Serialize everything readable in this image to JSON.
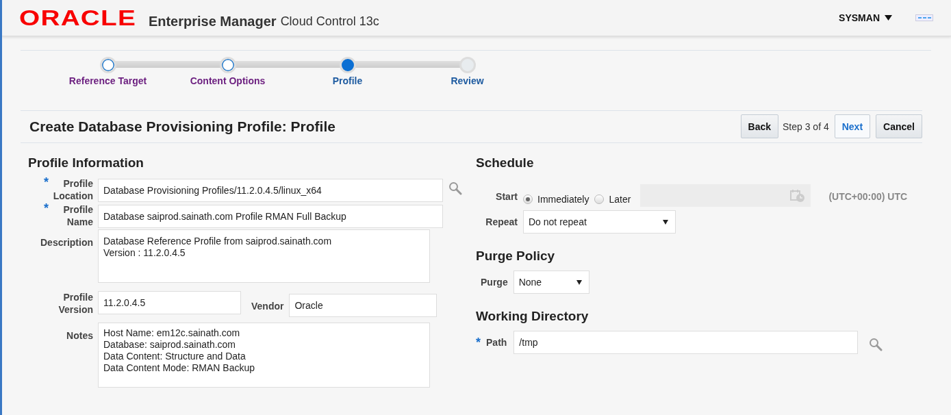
{
  "header": {
    "logo": "ORACLE",
    "product": "Enterprise Manager",
    "edition": "Cloud Control 13c",
    "user": "SYSMAN"
  },
  "train": [
    {
      "label": "Reference Target",
      "visited": true,
      "selected": false
    },
    {
      "label": "Content Options",
      "visited": true,
      "selected": false
    },
    {
      "label": "Profile",
      "visited": false,
      "selected": true
    },
    {
      "label": "Review",
      "visited": false,
      "selected": false
    }
  ],
  "page_title": "Create Database Provisioning Profile: Profile",
  "nav": {
    "back": "Back",
    "step": "Step 3 of 4",
    "next": "Next",
    "next_hovered": true,
    "cancel": "Cancel"
  },
  "profile_information": {
    "title": "Profile Information",
    "fields": [
      {
        "kind": "search",
        "label": "Profile Location",
        "required_mark": "*",
        "value": "Database Provisioning Profiles/11.2.0.4.5/linux_x64"
      },
      {
        "kind": "text",
        "label": "Profile Name",
        "required_mark": "*",
        "value": "Database saiprod.sainath.com Profile RMAN Full Backup"
      },
      {
        "kind": "textarea",
        "label": "Description",
        "value": "Database Reference Profile from saiprod.sainath.com\nVersion : 11.2.0.4.5"
      },
      {
        "kind": "pair",
        "label": "Profile Version",
        "value": "11.2.0.4.5",
        "label2": "Vendor",
        "value2": "Oracle"
      },
      {
        "kind": "notes",
        "label": "Notes",
        "value": "Host Name: em12c.sainath.com\nDatabase: saiprod.sainath.com\nData Content: Structure and Data\nData Content Mode: RMAN Backup"
      }
    ]
  },
  "schedule": {
    "title": "Schedule",
    "start_label": "Start",
    "options": [
      {
        "label": "Immediately",
        "selected": true
      },
      {
        "label": "Later",
        "selected": false
      }
    ],
    "date_disabled": true,
    "timezone": "(UTC+00:00) UTC",
    "repeat_label": "Repeat",
    "repeat": "Do not repeat"
  },
  "purge_policy": {
    "title": "Purge Policy",
    "label": "Purge",
    "value": "None"
  },
  "working_directory": {
    "title": "Working Directory",
    "label": "Path",
    "required_mark": "*",
    "value": "/tmp"
  }
}
